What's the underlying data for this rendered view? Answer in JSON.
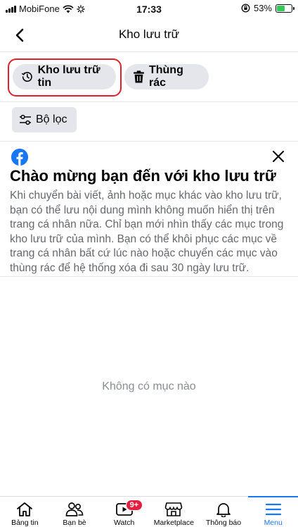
{
  "status_bar": {
    "carrier": "MobiFone",
    "time": "17:33",
    "battery": "53%",
    "battery_level": 0.53
  },
  "header": {
    "title": "Kho lưu trữ",
    "back_icon": "chevron-left-icon"
  },
  "tabs": {
    "archive_label": "Kho lưu trữ tin",
    "trash_label": "Thùng rác"
  },
  "filter": {
    "label": "Bộ lọc"
  },
  "welcome": {
    "title": "Chào mừng bạn đến với kho lưu trữ",
    "body": "Khi chuyển bài viết, ảnh hoặc mục khác vào kho lưu trữ, bạn có thể lưu nội dung mình không muốn hiển thị trên trang cá nhân nữa. Chỉ bạn mới nhìn thấy các mục trong kho lưu trữ của mình. Bạn có thể khôi phục các mục về trang cá nhân bất cứ lúc nào hoặc chuyển các mục vào thùng rác để hệ thống xóa đi sau 30 ngày lưu trữ."
  },
  "empty_state": "Không có mục nào",
  "bottom_nav": {
    "items": [
      {
        "label": "Bảng tin",
        "icon": "home-icon"
      },
      {
        "label": "Bạn bè",
        "icon": "friends-icon"
      },
      {
        "label": "Watch",
        "icon": "watch-icon",
        "badge": "9+"
      },
      {
        "label": "Marketplace",
        "icon": "marketplace-icon"
      },
      {
        "label": "Thông báo",
        "icon": "bell-icon"
      },
      {
        "label": "Menu",
        "icon": "menu-icon",
        "active": true
      }
    ]
  },
  "colors": {
    "accent": "#1877f2",
    "highlight": "#e0212b",
    "badge": "#e41e3f"
  }
}
